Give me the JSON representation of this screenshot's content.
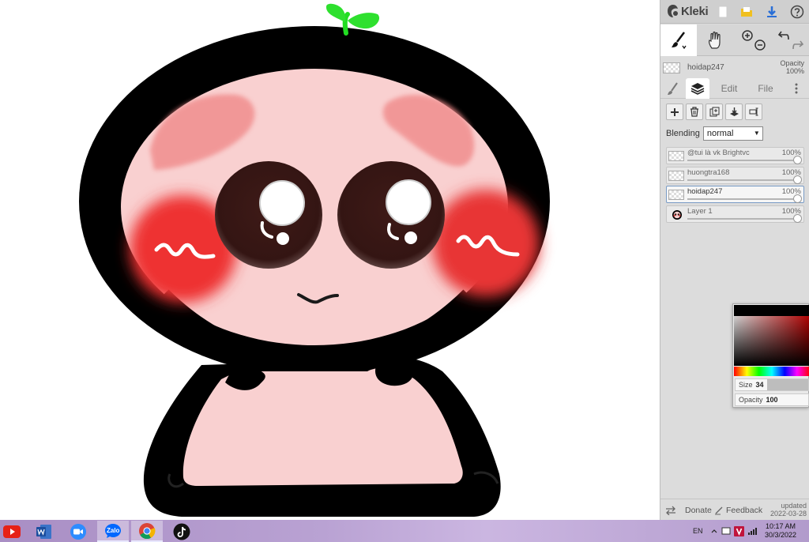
{
  "app": {
    "name": "Kleki"
  },
  "layer_status": {
    "name": "hoidap247",
    "opacity_label": "Opacity",
    "opacity_value": "100%"
  },
  "tabs": {
    "edit": "Edit",
    "file": "File"
  },
  "blending": {
    "label": "Blending",
    "value": "normal"
  },
  "layers": [
    {
      "name": "@tui là vk Brightvc",
      "opacity": "100%"
    },
    {
      "name": "huongtra168",
      "opacity": "100%"
    },
    {
      "name": "hoidap247",
      "opacity": "100%",
      "selected": true
    },
    {
      "name": "Layer 1",
      "opacity": "100%"
    }
  ],
  "picker": {
    "size_label": "Size",
    "size_value": "34",
    "opacity_label": "Opacity",
    "opacity_value": "100"
  },
  "bottom": {
    "donate": "Donate",
    "feedback": "Feedback",
    "updated_label": "updated",
    "updated_date": "2022-03-28"
  },
  "taskbar": {
    "apps": [
      "youtube-icon",
      "word-icon",
      "zoom-icon",
      "zalo-icon",
      "chrome-icon",
      "tiktok-icon"
    ],
    "zalo_label": "Zalo",
    "language": "EN",
    "time": "10:17 AM",
    "date": "30/3/2022"
  },
  "colors": {
    "accent": "#2a6fd6",
    "face": "#f9d0d0",
    "outline": "#000000",
    "cheek": "#ee3a3a",
    "eye": "#3b1a18",
    "sprout": "#2ee02e"
  }
}
